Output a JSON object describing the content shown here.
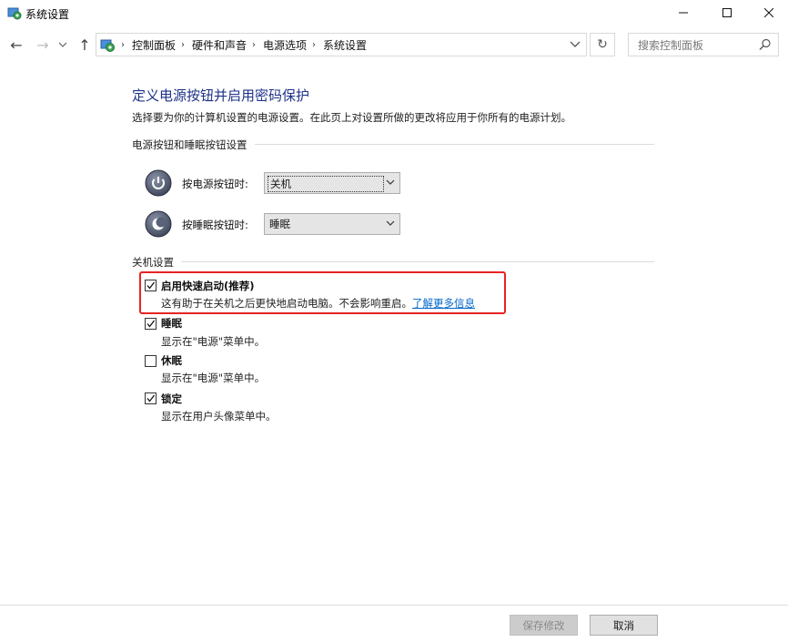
{
  "window": {
    "title": "系统设置"
  },
  "nav": {
    "breadcrumbs": [
      "控制面板",
      "硬件和声音",
      "电源选项",
      "系统设置"
    ],
    "search_placeholder": "搜索控制面板"
  },
  "page": {
    "title": "定义电源按钮并启用密码保护",
    "description": "选择要为你的计算机设置的电源设置。在此页上对设置所做的更改将应用于你所有的电源计划。"
  },
  "power_buttons": {
    "group_label": "电源按钮和睡眠按钮设置",
    "power_button": {
      "label": "按电源按钮时:",
      "value": "关机"
    },
    "sleep_button": {
      "label": "按睡眠按钮时:",
      "value": "睡眠"
    }
  },
  "shutdown": {
    "group_label": "关机设置",
    "options": [
      {
        "label": "启用快速启动(推荐)",
        "desc": "这有助于在关机之后更快地启动电脑。不会影响重启。",
        "link": "了解更多信息",
        "checked": true
      },
      {
        "label": "睡眠",
        "desc": "显示在\"电源\"菜单中。",
        "checked": true
      },
      {
        "label": "休眠",
        "desc": "显示在\"电源\"菜单中。",
        "checked": false
      },
      {
        "label": "锁定",
        "desc": "显示在用户头像菜单中。",
        "checked": true
      }
    ]
  },
  "footer": {
    "save_label": "保存修改",
    "cancel_label": "取消"
  },
  "colors": {
    "title": "#1e3287",
    "link": "#0066cc",
    "highlight": "#e82323"
  }
}
